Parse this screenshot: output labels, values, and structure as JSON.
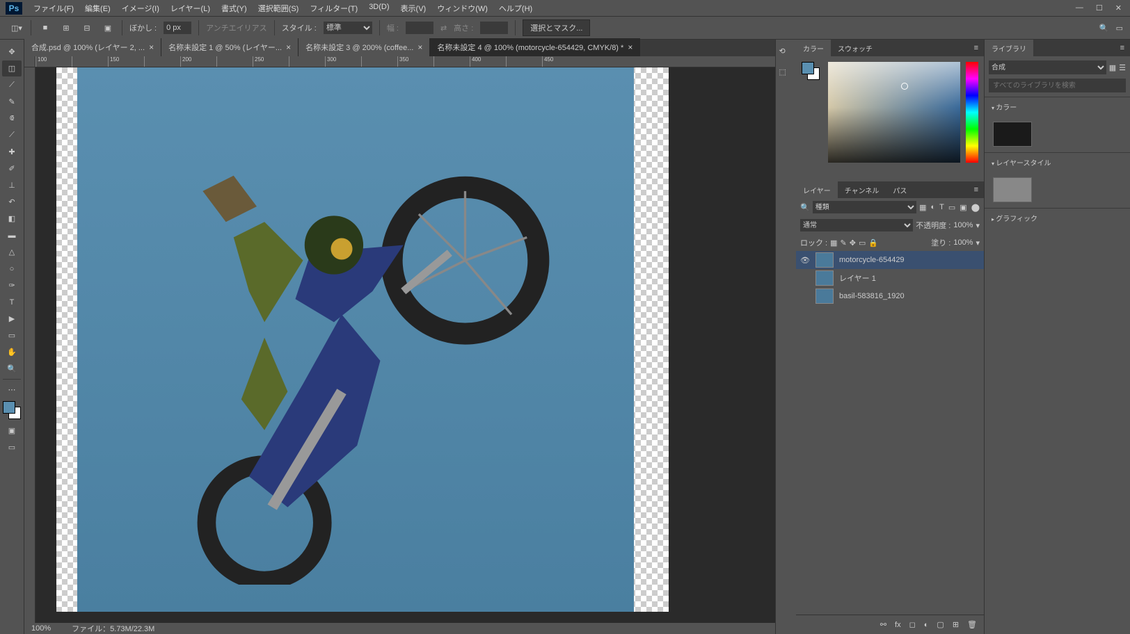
{
  "menubar": {
    "items": [
      "ファイル(F)",
      "編集(E)",
      "イメージ(I)",
      "レイヤー(L)",
      "書式(Y)",
      "選択範囲(S)",
      "フィルター(T)",
      "3D(D)",
      "表示(V)",
      "ウィンドウ(W)",
      "ヘルプ(H)"
    ]
  },
  "optbar": {
    "feather_label": "ぼかし :",
    "feather_value": "0 px",
    "antialias": "アンチエイリアス",
    "style_label": "スタイル :",
    "style_value": "標準",
    "width_label": "幅 :",
    "height_label": "高さ :",
    "select_mask": "選択とマスク..."
  },
  "tabs": [
    {
      "title": "合成.psd @ 100% (レイヤー 2, ...",
      "active": false
    },
    {
      "title": "名称未設定 1 @ 50% (レイヤー...",
      "active": false
    },
    {
      "title": "名称未設定 3 @ 200% (coffee...",
      "active": false
    },
    {
      "title": "名称未設定 4 @ 100% (motorcycle-654429, CMYK/8) *",
      "active": true
    }
  ],
  "ruler_marks": [
    "100",
    "",
    "150",
    "",
    "200",
    "",
    "250",
    "",
    "300",
    "",
    "350",
    "",
    "400",
    "",
    "450"
  ],
  "status": {
    "zoom": "100%",
    "doc": "ファイル：5.73M/22.3M"
  },
  "panel_color": {
    "tabs": [
      "カラー",
      "スウォッチ"
    ]
  },
  "panel_layers": {
    "tabs": [
      "レイヤー",
      "チャンネル",
      "パス"
    ],
    "kind_label": "種類",
    "blend": "通常",
    "opacity_label": "不透明度 :",
    "opacity_value": "100%",
    "lock_label": "ロック :",
    "fill_label": "塗り :",
    "fill_value": "100%",
    "layers": [
      {
        "name": "motorcycle-654429",
        "visible": true,
        "active": true
      },
      {
        "name": "レイヤー 1",
        "visible": false,
        "active": false
      },
      {
        "name": "basil-583816_1920",
        "visible": false,
        "active": false
      }
    ]
  },
  "panel_lib": {
    "title": "ライブラリ",
    "select": "合成",
    "search_placeholder": "すべてのライブラリを検索",
    "sections": {
      "color": "カラー",
      "layerstyle": "レイヤースタイル",
      "graphic": "グラフィック"
    }
  }
}
